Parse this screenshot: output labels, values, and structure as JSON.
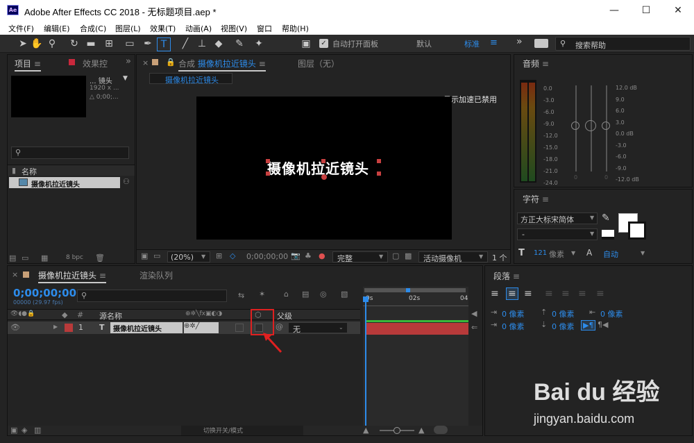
{
  "window": {
    "app_icon": "Ae",
    "title": "Adobe After Effects CC 2018 - 无标题项目.aep *",
    "minimize": "—",
    "maximize": "☐",
    "close": "✕"
  },
  "menu": [
    "文件(F)",
    "编辑(E)",
    "合成(C)",
    "图层(L)",
    "效果(T)",
    "动画(A)",
    "视图(V)",
    "窗口",
    "帮助(H)"
  ],
  "toolbar": {
    "auto_open_label": "自动打开面板",
    "workspace_default": "默认",
    "workspace_standard": "标准",
    "search_placeholder": "搜索帮助"
  },
  "project_panel": {
    "tab_project": "项目",
    "tab_effects": "效果控",
    "thumb_title": "... 镜头",
    "thumb_size": "1920 x ...",
    "thumb_duration": "△ 0;00;...",
    "column_name": "名称",
    "item_name": "摄像机拉近镜头",
    "bpc": "8 bpc"
  },
  "comp_panel": {
    "tab_label": "合成",
    "comp_name": "摄像机拉近镜头",
    "layer_tab": "图层（无）",
    "breadcrumb": "摄像机拉近镜头",
    "gpu_notice": "显示加速已禁用",
    "canvas_text": "摄像机拉近镜头",
    "zoom": "(20%)",
    "timecode": "0;00;00;00",
    "resolution": "完整",
    "camera": "活动摄像机",
    "view_count": "1 个"
  },
  "audio_panel": {
    "title": "音频",
    "left_scale": [
      "0.0",
      "-3.0",
      "-6.0",
      "-9.0",
      "-12.0",
      "-15.0",
      "-18.0",
      "-21.0",
      "-24.0"
    ],
    "right_scale": [
      "12.0 dB",
      "9.0",
      "6.0",
      "3.0",
      "0.0 dB",
      "-3.0",
      "-6.0",
      "-9.0",
      "-12.0 dB"
    ],
    "zero_a": "0",
    "zero_b": "0"
  },
  "character_panel": {
    "title": "字符",
    "font": "方正大标宋简体",
    "style": "-",
    "size_value": "121",
    "size_unit": "像素",
    "tracking": "自动"
  },
  "paragraph_panel": {
    "title": "段落",
    "indent_left": "0 像素",
    "indent_first": "0 像素",
    "indent_right": "0 像素",
    "space_before": "0 像素",
    "space_after": "0 像素"
  },
  "timeline": {
    "tab_comp": "摄像机拉近镜头",
    "tab_render": "渲染队列",
    "timecode": "0;00;00;00",
    "frame_info": "00000 (29.97 fps)",
    "col_num": "#",
    "col_source": "源名称",
    "col_parent": "父级",
    "layer_num": "1",
    "layer_type": "T",
    "layer_name": "摄像机拉近镜头",
    "parent_value": "无",
    "ruler": [
      "0s",
      "02s",
      "04"
    ],
    "footer_toggle": "切换开关/模式"
  },
  "watermark": {
    "brand": "Bai du 经验",
    "url": "jingyan.baidu.com"
  },
  "colors": {
    "accent_blue": "#2d8ceb",
    "layer_red": "#b83a3a",
    "highlight_box": "#e02020"
  }
}
